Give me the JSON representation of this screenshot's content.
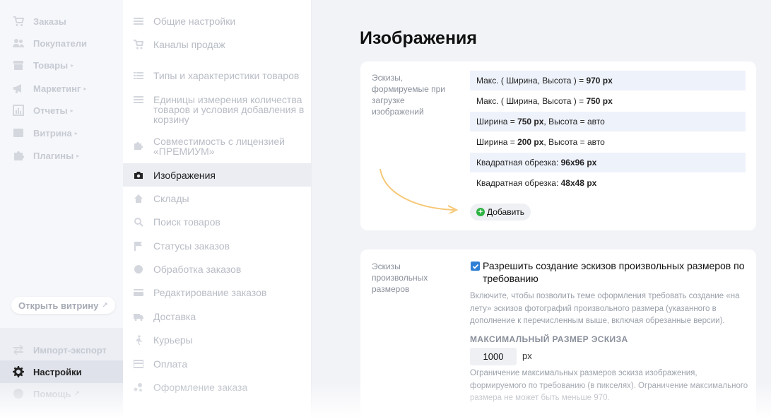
{
  "nav": {
    "items": [
      {
        "label": "Заказы",
        "icon": "cart-icon",
        "caret": ""
      },
      {
        "label": "Покупатели",
        "icon": "users-icon",
        "caret": ""
      },
      {
        "label": "Товары",
        "icon": "box-icon",
        "caret": "▸"
      },
      {
        "label": "Маркетинг",
        "icon": "megaphone-icon",
        "caret": "▸"
      },
      {
        "label": "Отчеты",
        "icon": "chart-icon",
        "caret": "▸"
      },
      {
        "label": "Витрина",
        "icon": "store-icon",
        "caret": "▸"
      },
      {
        "label": "Плагины",
        "icon": "puzzle-icon",
        "caret": "▸"
      }
    ],
    "open_store": "Открыть витрину",
    "bottom": [
      {
        "label": "Импорт-экспорт",
        "icon": "exchange-icon"
      },
      {
        "label": "Настройки",
        "icon": "gear-icon"
      },
      {
        "label": "Помощь",
        "icon": "help-icon"
      }
    ]
  },
  "submenu": {
    "items": [
      {
        "label": "Общие настройки"
      },
      {
        "label": "Каналы продаж"
      },
      {
        "label": "Типы и характеристики товаров"
      },
      {
        "label": "Единицы измерения количества товаров и условия добавления в корзину"
      },
      {
        "label": "Совместимость с лицензией «ПРЕМИУМ»"
      },
      {
        "label": "Изображения"
      },
      {
        "label": "Склады"
      },
      {
        "label": "Поиск товаров"
      },
      {
        "label": "Статусы заказов"
      },
      {
        "label": "Обработка заказов"
      },
      {
        "label": "Редактирование заказов"
      },
      {
        "label": "Доставка"
      },
      {
        "label": "Курьеры"
      },
      {
        "label": "Оплата"
      },
      {
        "label": "Оформление заказа"
      }
    ],
    "active": "Изображения"
  },
  "page": {
    "title": "Изображения"
  },
  "thumbs": {
    "label": "Эскизы, формируемые при загрузке изображений",
    "rows": [
      {
        "prefix": "Макс. ( Ширина, Высота ) = ",
        "value": "970 px",
        "suffix": ""
      },
      {
        "prefix": "Макс. ( Ширина, Высота ) = ",
        "value": "750 px",
        "suffix": ""
      },
      {
        "prefix": "Ширина = ",
        "value": "750 px",
        "suffix": ", Высота = авто"
      },
      {
        "prefix": "Ширина = ",
        "value": "200 px",
        "suffix": ", Высота = авто"
      },
      {
        "prefix": "Квадратная обрезка: ",
        "value": "96x96 px",
        "suffix": ""
      },
      {
        "prefix": "Квадратная обрезка: ",
        "value": "48x48 px",
        "suffix": ""
      }
    ],
    "add_label": "Добавить",
    "arrow_color": "#f6c877"
  },
  "custom": {
    "label": "Эскизы произвольных размеров",
    "checkbox_label": "Разрешить создание эскизов произвольных размеров по требованию",
    "checked": true,
    "hint": "Включите, чтобы позволить теме оформления требовать создание «на лету» эскизов фотографий произвольного размера (указанного в дополнение к перечисленным выше, включая обрезанные версии).",
    "max_title": "МАКСИМАЛЬНЫЙ РАЗМЕР ЭСКИЗА",
    "max_value": "1000",
    "unit": "px",
    "max_hint": "Ограничение максимальных размеров эскиза изображения, формируемого по требованию (в пикселях). Ограничение максимального размера не может быть меньше 970."
  },
  "colors": {
    "accent": "#2f7fd6",
    "add_green": "#2fb344"
  }
}
